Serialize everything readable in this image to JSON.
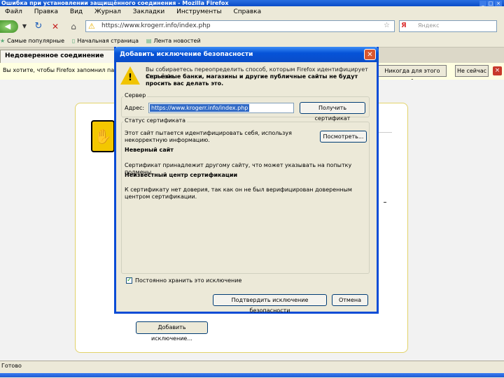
{
  "window": {
    "title": "Ошибка при установлении защищённого соединения - Mozilla Firefox"
  },
  "menubar": [
    "Файл",
    "Правка",
    "Вид",
    "Журнал",
    "Закладки",
    "Инструменты",
    "Справка"
  ],
  "navbar": {
    "url": "https://www.krogerr.info/index.php",
    "search_placeholder": "Яндекс",
    "search_engine_icon": "yandex-icon"
  },
  "bookmarks": [
    "Самые популярные",
    "Начальная страница",
    "Лента новостей"
  ],
  "tab": {
    "label": "Недоверенное соединение"
  },
  "notification": {
    "text": "Вы хотите, чтобы Firefox запомнил пароль",
    "never_site_label": "Никогда для этого сайта",
    "not_now_label": "Не сейчас"
  },
  "page": {
    "add_exception_label": "Добавить исключение..."
  },
  "dialog": {
    "title": "Добавить исключение безопасности",
    "warning_text": "Вы собираетесь переопределить способ, которым Firefox идентифицирует этот сайт.",
    "warning_bold": "Серьёзные банки, магазины и другие публичные сайты не будут просить вас делать это.",
    "server_legend": "Сервер",
    "address_label": "Адрес:",
    "address_value": "https://www.krogerr.info/index.php",
    "get_cert_label": "Получить сертификат",
    "status_legend": "Статус сертификата",
    "view_label": "Посмотреть...",
    "status_intro": "Этот сайт пытается идентифицировать себя, используя некорректную информацию.",
    "wrong_site_heading": "Неверный сайт",
    "wrong_site_text": "Сертификат принадлежит другому сайту, что может указывать на попытку подмены.",
    "unknown_ca_heading": "Неизвестный центр сертификации",
    "unknown_ca_text": "К сертификату нет доверия, так как он не был верифицирован доверенным центром сертификации.",
    "permanent_label": "Постоянно хранить это исключение",
    "permanent_checked": true,
    "confirm_label": "Подтвердить исключение безопасности",
    "cancel_label": "Отмена"
  },
  "statusbar": {
    "text": "Готово"
  },
  "colors": {
    "dialog_title": "#0a4cc8",
    "warning": "#f1c400",
    "selection": "#316ac5"
  }
}
